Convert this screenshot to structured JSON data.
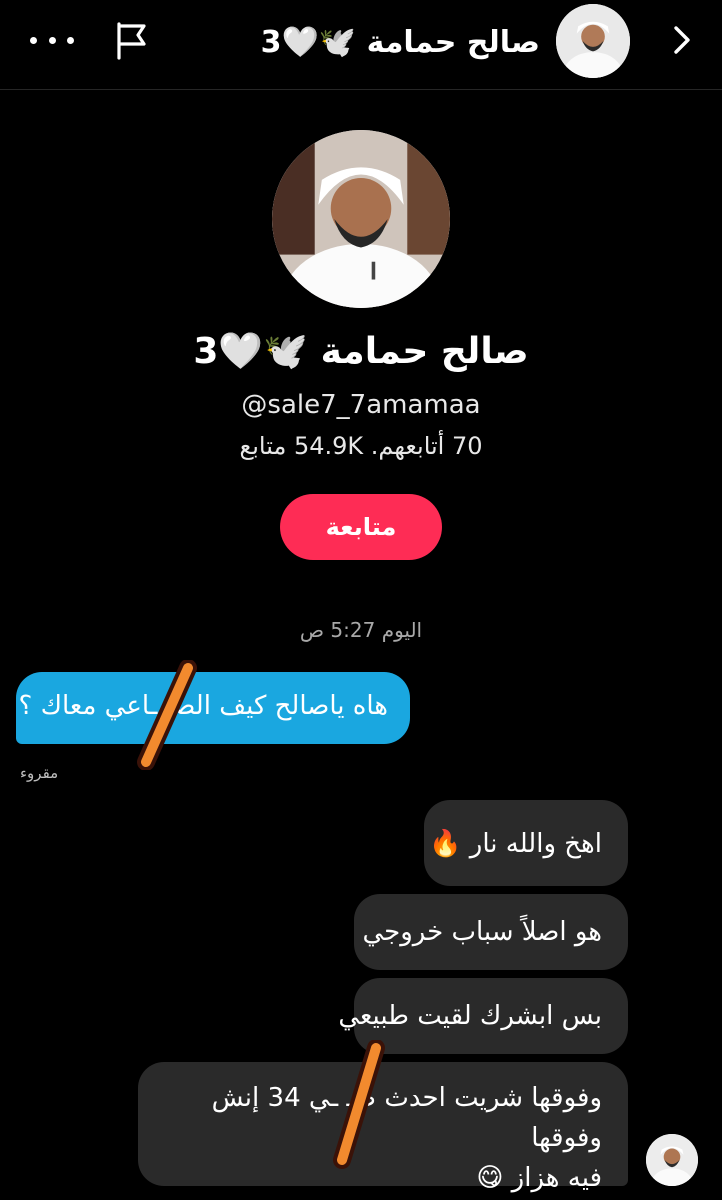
{
  "header": {
    "title": "صالح حمامة 🕊️🤍3",
    "back_icon": "chevron-right-icon",
    "flag_icon": "flag-icon",
    "more_icon": "more-horizontal-icon"
  },
  "profile": {
    "name": "صالح حمامة 🕊️🤍3",
    "handle": "@sale7_7amamaa",
    "stats": "70 أتابعهم. 54.9K متابع",
    "follow_label": "متابعة"
  },
  "chat": {
    "timestamp": "اليوم 5:27 ص",
    "outgoing": {
      "text": "هاه ياصالح كيف الصـ ـاعي معاك ؟",
      "status": "مقروء"
    },
    "incoming": [
      {
        "text": "اهخ والله نار 🔥"
      },
      {
        "text": "هو اصلاً سباب خروجي"
      },
      {
        "text": "بس ابشرك لقيت طبيعي"
      },
      {
        "line1": "وفوقها شريت احدث صـ ـي 34 إنش وفوقها",
        "line2": "فيه هزاز 😋"
      }
    ]
  },
  "colors": {
    "background": "#000000",
    "accent": "#fe2c55",
    "outgoing_bubble": "#1aa7e0",
    "incoming_bubble": "#2a2a2a",
    "redaction": "#f28a2e"
  }
}
